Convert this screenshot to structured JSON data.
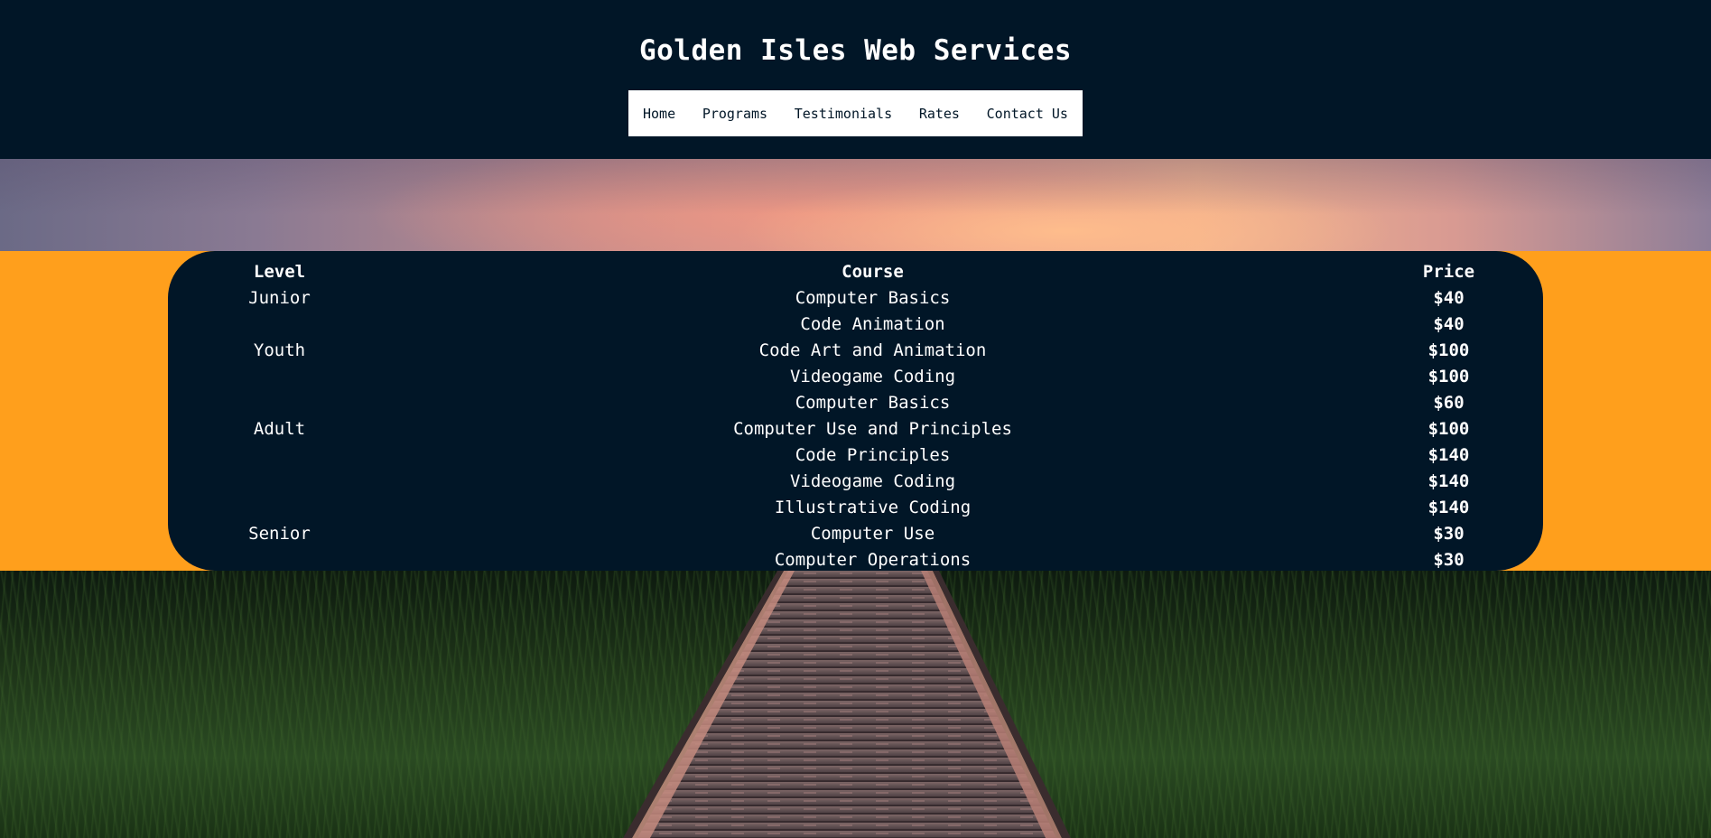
{
  "site": {
    "title": "Golden Isles Web Services"
  },
  "nav": {
    "items": [
      {
        "label": "Home",
        "name": "nav-home"
      },
      {
        "label": "Programs",
        "name": "nav-programs"
      },
      {
        "label": "Testimonials",
        "name": "nav-testimonials"
      },
      {
        "label": "Rates",
        "name": "nav-rates"
      },
      {
        "label": "Contact Us",
        "name": "nav-contact-us"
      }
    ]
  },
  "rates": {
    "headers": {
      "level": "Level",
      "course": "Course",
      "price": "Price"
    },
    "rows": [
      {
        "level": "Junior",
        "course": "Computer Basics",
        "price": "$40"
      },
      {
        "level": "",
        "course": "Code Animation",
        "price": "$40"
      },
      {
        "level": "Youth",
        "course": "Code Art and Animation",
        "price": "$100"
      },
      {
        "level": "",
        "course": "Videogame Coding",
        "price": "$100"
      },
      {
        "level": "",
        "course": "Computer Basics",
        "price": "$60"
      },
      {
        "level": "Adult",
        "course": "Computer Use and Principles",
        "price": "$100"
      },
      {
        "level": "",
        "course": "Code Principles",
        "price": "$140"
      },
      {
        "level": "",
        "course": "Videogame Coding",
        "price": "$140"
      },
      {
        "level": "",
        "course": "Illustrative Coding",
        "price": "$140"
      },
      {
        "level": "Senior",
        "course": "Computer Use",
        "price": "$30"
      },
      {
        "level": "",
        "course": "Computer Operations",
        "price": "$30"
      }
    ]
  },
  "colors": {
    "navy": "#011627",
    "accent_orange": "#ff9f1c",
    "text_white": "#ffffff"
  }
}
